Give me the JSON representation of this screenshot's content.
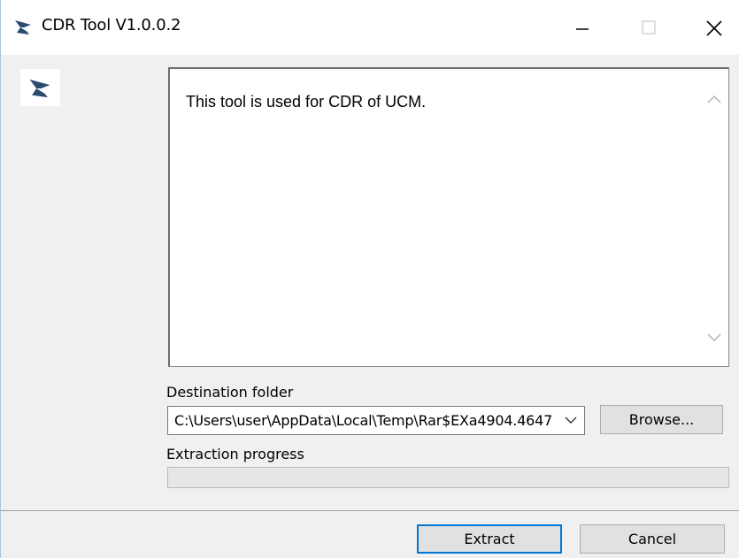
{
  "window": {
    "title": "CDR Tool V1.0.0.2"
  },
  "description": {
    "text": "This tool is used for CDR of UCM."
  },
  "destination": {
    "label": "Destination folder",
    "value": "C:\\Users\\user\\AppData\\Local\\Temp\\Rar$EXa4904.4647",
    "browse_label": "Browse..."
  },
  "progress": {
    "label": "Extraction progress",
    "value_percent": 0
  },
  "actions": {
    "extract_label": "Extract",
    "cancel_label": "Cancel"
  },
  "icons": {
    "app": "grandstream-logo-icon",
    "minimize": "minimize-icon",
    "maximize": "maximize-icon",
    "close": "close-icon",
    "scroll_up": "chevron-up-icon",
    "scroll_down": "chevron-down-icon",
    "dropdown": "chevron-down-icon"
  },
  "colors": {
    "accent": "#0078d7",
    "logo": "#2b4a6f",
    "progress_fill": "#06b025"
  }
}
